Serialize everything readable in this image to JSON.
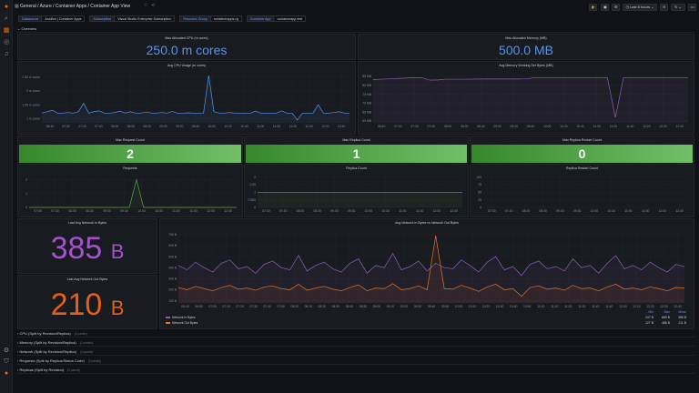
{
  "header": {
    "breadcrumb": "General / Azure / Container Apps / Container App View",
    "time_range": "Last 6 hours",
    "icons": [
      "grid-icon",
      "star-icon",
      "share-icon",
      "bar-chart-add-icon",
      "save-icon",
      "gear-icon",
      "clock-icon",
      "zoom-out-icon",
      "refresh-icon",
      "tv-icon"
    ]
  },
  "variables": [
    {
      "label": "Datasource",
      "value": "Ancillon | Container Apps"
    },
    {
      "label": "Subscription",
      "value": "Visual Studio Enterprise Subscription"
    },
    {
      "label": "Resource Group",
      "value": "containerapps-rg"
    },
    {
      "label": "Container App",
      "value": "containerapp-test"
    }
  ],
  "overview_row": "Overview",
  "stats": {
    "cpu_alloc": {
      "title": "Max Allocated CPU (m cores)",
      "value": "250.0 m cores"
    },
    "mem_alloc": {
      "title": "Max Allocated Memory (MB)",
      "value": "500.0 MB"
    },
    "requests": {
      "title": "Max Request Count",
      "value": "2"
    },
    "replicas": {
      "title": "Max Replica Count",
      "value": "1"
    },
    "restarts": {
      "title": "Max Replica Restart Count",
      "value": "0"
    },
    "net_in": {
      "title": "Last Avg Network In Bytes",
      "value": "385",
      "unit": "B",
      "color": "#a352cc"
    },
    "net_out": {
      "title": "Last Avg Network Out Bytes",
      "value": "210",
      "unit": "B",
      "color": "#e55f14"
    }
  },
  "charts": {
    "cpu": {
      "title": "Avg CPU Usage (m cores)",
      "ymin": 0.85,
      "ymax": 2.65,
      "yticks": [
        {
          "v": 1,
          "label": "1 m cores"
        },
        {
          "v": 1.5,
          "label": "1.50 m cores"
        },
        {
          "v": 2,
          "label": "2 m cores"
        },
        {
          "v": 2.5,
          "label": "2.50 m cores"
        }
      ],
      "xticks": [
        "06:40",
        "07:00",
        "07:20",
        "07:40",
        "08:00",
        "08:20",
        "08:40",
        "09:00",
        "09:20",
        "09:40",
        "10:00",
        "10:20",
        "10:40",
        "11:00",
        "11:20",
        "11:40",
        "12:00",
        "12:20",
        "12:40"
      ],
      "series": [
        {
          "color": "#5794f2",
          "values": [
            1.2,
            1.25,
            1.3,
            1.2,
            1.2,
            1.22,
            1.2,
            1.25,
            1.55,
            1.2,
            1.25,
            1.28,
            1.2,
            1.2,
            1.22,
            1.27,
            1.2,
            1.25,
            1.2,
            1.2,
            1.24,
            1.2,
            1.2,
            1.22,
            1.2,
            1.26,
            1.2,
            1.2,
            1.21,
            1.2,
            1.2,
            1.2,
            2.55,
            1.25,
            1.2,
            1.2,
            1.22,
            1.2,
            1.2,
            1.2,
            1.2,
            1.27,
            1.2,
            1.2,
            1.2,
            1.2,
            1.28,
            1.2,
            1.2,
            0.95,
            1.2,
            1.2,
            1.2,
            1.5,
            1.2,
            1.2,
            1.22,
            1.25,
            1.2,
            1.2
          ]
        }
      ]
    },
    "memory": {
      "title": "Avg Memory Working Set Bytes (MB)",
      "ymin": 59,
      "ymax": 87,
      "yticks": [
        {
          "v": 60,
          "label": "60 MB"
        },
        {
          "v": 65,
          "label": "65 MB"
        },
        {
          "v": 70,
          "label": "70 MB"
        },
        {
          "v": 75,
          "label": "75 MB"
        },
        {
          "v": 80,
          "label": "80 MB"
        },
        {
          "v": 85,
          "label": "85 MB"
        }
      ],
      "xticks": [
        "06:40",
        "07:00",
        "07:20",
        "07:40",
        "08:00",
        "08:20",
        "08:40",
        "09:00",
        "09:20",
        "09:40",
        "10:00",
        "10:20",
        "10:40",
        "11:00",
        "11:20",
        "11:40",
        "12:00",
        "12:20",
        "12:40"
      ],
      "series": [
        {
          "color": "#8f5fb8",
          "values": [
            83.2,
            83.4,
            83.6,
            83.8,
            84.0,
            84.2,
            84.3,
            82.9,
            83.0,
            83.4,
            83.4,
            83.4,
            83.4,
            83.5,
            83.5,
            83.5,
            83.5,
            83.5,
            83.5,
            83.6,
            84.3,
            84.3,
            84.3,
            84.3,
            84.3,
            84.3,
            84.3,
            84.3,
            84.3,
            84.3,
            62.0,
            84.3,
            84.3,
            84.3,
            84.3,
            84.3,
            84.3,
            84.3,
            84.3,
            84.3
          ]
        }
      ]
    },
    "requests": {
      "title": "Requests",
      "ymin": 0,
      "ymax": 2.3,
      "yticks": [
        {
          "v": 0,
          "label": "0"
        },
        {
          "v": 1,
          "label": "1"
        },
        {
          "v": 2,
          "label": "2"
        }
      ],
      "xticks": [
        "07:00",
        "07:30",
        "08:00",
        "08:30",
        "09:00",
        "09:30",
        "10:00",
        "10:30",
        "11:00",
        "11:30",
        "12:00",
        "12:30"
      ],
      "series": [
        {
          "color": "#56a64b",
          "values": [
            0,
            0,
            0,
            0,
            0,
            0,
            0,
            0,
            0,
            0,
            0,
            0,
            0,
            0,
            0,
            2,
            0,
            0,
            0,
            0,
            0,
            0,
            0,
            0,
            0,
            0,
            0,
            0,
            0,
            0
          ]
        }
      ]
    },
    "replica_count": {
      "title": "Replica Count",
      "ymin": 0,
      "ymax": 2.1,
      "yticks": [
        {
          "v": 0,
          "label": "0"
        },
        {
          "v": 0.5,
          "label": "0.500"
        },
        {
          "v": 1,
          "label": "1"
        },
        {
          "v": 1.5,
          "label": "1.50"
        },
        {
          "v": 2,
          "label": "2"
        }
      ],
      "xticks": [
        "07:00",
        "07:30",
        "08:00",
        "08:30",
        "09:00",
        "09:30",
        "10:00",
        "10:30",
        "11:00",
        "11:30",
        "12:00",
        "12:30"
      ],
      "series": [
        {
          "color": "#56a64b",
          "values": [
            1,
            1,
            1,
            1,
            1,
            1,
            1,
            1,
            1,
            1,
            1,
            1,
            1,
            1,
            1,
            1,
            1,
            1,
            1,
            1
          ]
        }
      ]
    },
    "restart_count": {
      "title": "Replica Restart Count",
      "ymin": 0,
      "ymax": 105,
      "yticks": [
        {
          "v": 0,
          "label": "0"
        },
        {
          "v": 25,
          "label": "25"
        },
        {
          "v": 50,
          "label": "50"
        },
        {
          "v": 75,
          "label": "75"
        },
        {
          "v": 100,
          "label": "100"
        }
      ],
      "xticks": [
        "07:00",
        "07:30",
        "08:00",
        "08:30",
        "09:00",
        "09:30",
        "10:00",
        "10:30",
        "11:00",
        "11:30",
        "12:00",
        "12:30"
      ],
      "series": []
    },
    "network": {
      "title": "Avg Network In Bytes vs Network Out Bytes",
      "ymin": 80,
      "ymax": 740,
      "yticks": [
        {
          "v": 100,
          "label": "100 B"
        },
        {
          "v": 200,
          "label": "200 B"
        },
        {
          "v": 300,
          "label": "300 B"
        },
        {
          "v": 400,
          "label": "400 B"
        },
        {
          "v": 500,
          "label": "500 B"
        },
        {
          "v": 600,
          "label": "600 B"
        },
        {
          "v": 700,
          "label": "700 B"
        }
      ],
      "xticks": [
        "06:40",
        "06:50",
        "07:00",
        "07:10",
        "07:20",
        "07:30",
        "07:40",
        "07:50",
        "08:00",
        "08:10",
        "08:20",
        "08:30",
        "08:40",
        "08:50",
        "09:00",
        "09:10",
        "09:20",
        "09:30",
        "09:40",
        "09:50",
        "10:00",
        "10:10",
        "10:20",
        "10:30",
        "10:40",
        "10:50",
        "11:00",
        "11:10",
        "11:20",
        "11:30",
        "11:40",
        "11:50",
        "12:00",
        "12:10",
        "12:20",
        "12:30",
        "12:40"
      ],
      "series": [
        {
          "name": "Network In Bytes",
          "color": "#8f5fb8",
          "min": "247 B",
          "max": "689 B",
          "mean": "385 B",
          "values": [
            420,
            380,
            450,
            400,
            360,
            440,
            470,
            390,
            410,
            350,
            430,
            460,
            400,
            380,
            510,
            370,
            420,
            450,
            390,
            360,
            440,
            480,
            350,
            420,
            400,
            530,
            380,
            410,
            460,
            370,
            440,
            400,
            390,
            470,
            420,
            360,
            450,
            500,
            380,
            410,
            330,
            430,
            460,
            390,
            410,
            370,
            480,
            400,
            420,
            350,
            440,
            510,
            390,
            420,
            380,
            450,
            400,
            360,
            430,
            410
          ]
        },
        {
          "name": "Network Out Bytes",
          "color": "#e0752d",
          "min": "127 B",
          "max": "486 B",
          "mean": "211 B",
          "values": [
            220,
            200,
            230,
            210,
            190,
            220,
            240,
            205,
            215,
            195,
            225,
            235,
            210,
            200,
            250,
            195,
            215,
            230,
            205,
            190,
            220,
            245,
            190,
            215,
            210,
            255,
            200,
            210,
            235,
            200,
            690,
            210,
            205,
            240,
            215,
            185,
            225,
            250,
            200,
            210,
            140,
            220,
            235,
            205,
            215,
            195,
            240,
            210,
            215,
            190,
            225,
            250,
            205,
            215,
            200,
            225,
            210,
            190,
            220,
            215
          ]
        }
      ],
      "legend_headers": [
        "Min",
        "Max",
        "Mean"
      ]
    }
  },
  "collapsed_rows": [
    {
      "title": "CPU (Split by Revision/Replica)",
      "count": "(2 panels)"
    },
    {
      "title": "Memory (Split by Revision/Replica)",
      "count": "(2 panels)"
    },
    {
      "title": "Network (Split by Revision/Replica)",
      "count": "(4 panels)"
    },
    {
      "title": "Requests (Split by Replica/Status Code)",
      "count": "(2 panels)"
    },
    {
      "title": "Replicas (Split by Revision)",
      "count": "(2 panels)"
    }
  ]
}
